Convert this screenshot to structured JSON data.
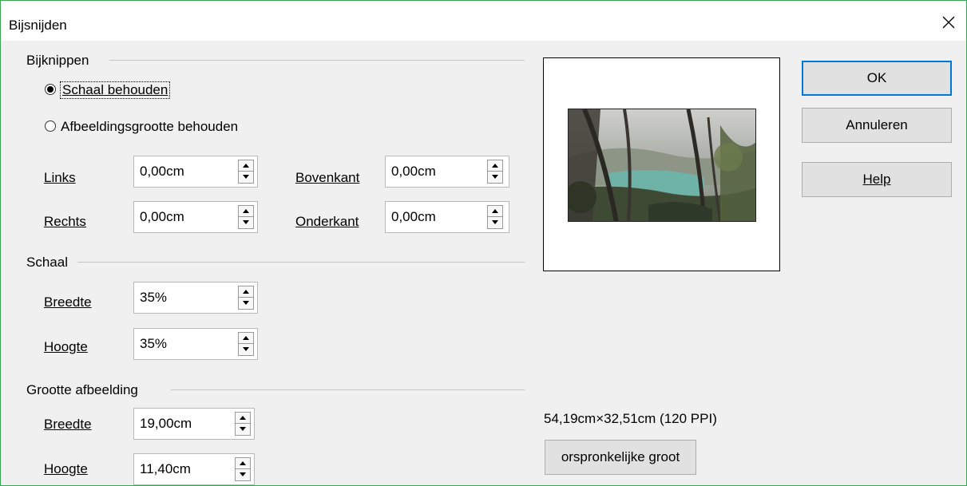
{
  "window": {
    "title": "Bijsnijden"
  },
  "crop": {
    "section": "Bijknippen",
    "keep_scale": "Schaal behouden",
    "keep_size": "Afbeeldingsgrootte behouden",
    "selected": "keep_scale",
    "left_label": "Links",
    "left_value": "0,00cm",
    "right_label": "Rechts",
    "right_value": "0,00cm",
    "top_label": "Bovenkant",
    "top_value": "0,00cm",
    "bottom_label": "Onderkant",
    "bottom_value": "0,00cm"
  },
  "scale": {
    "section": "Schaal",
    "width_label": "Breedte",
    "width_value": "35%",
    "height_label": "Hoogte",
    "height_value": "35%"
  },
  "size": {
    "section": "Grootte afbeelding",
    "width_label": "Breedte",
    "width_value": "19,00cm",
    "height_label": "Hoogte",
    "height_value": "11,40cm"
  },
  "original": {
    "info": "54,19cm×32,51cm (120 PPI)",
    "button": "orspronkelijke groot"
  },
  "buttons": {
    "ok": "OK",
    "cancel": "Annuleren",
    "help": "Help"
  },
  "icons": {
    "close": "close-icon",
    "spin_up": "spin-up-icon",
    "spin_down": "spin-down-icon"
  },
  "colors": {
    "accent": "#0078d7",
    "dialog_bg": "#f0f0f0",
    "window_border": "#3aa655"
  }
}
